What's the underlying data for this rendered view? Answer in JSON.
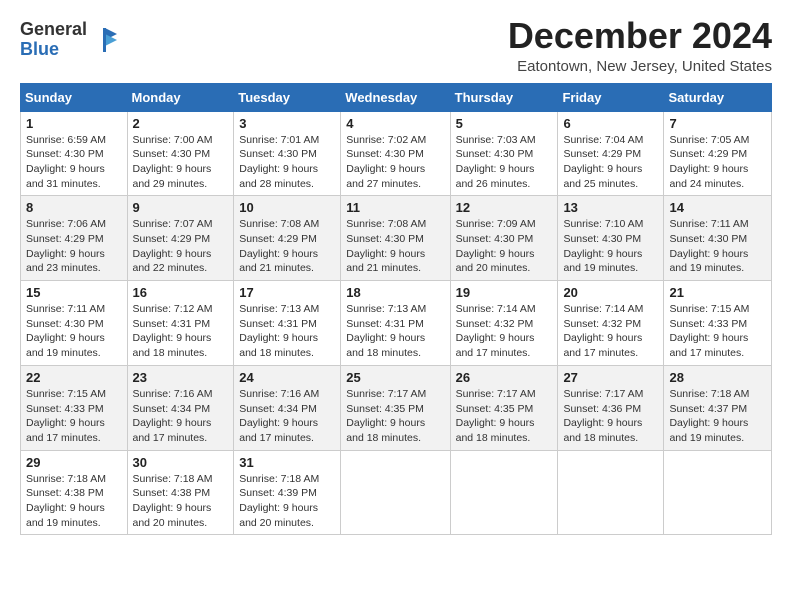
{
  "header": {
    "logo_general": "General",
    "logo_blue": "Blue",
    "month_title": "December 2024",
    "location": "Eatontown, New Jersey, United States"
  },
  "days_of_week": [
    "Sunday",
    "Monday",
    "Tuesday",
    "Wednesday",
    "Thursday",
    "Friday",
    "Saturday"
  ],
  "weeks": [
    [
      {
        "day": "1",
        "info": "Sunrise: 6:59 AM\nSunset: 4:30 PM\nDaylight: 9 hours\nand 31 minutes."
      },
      {
        "day": "2",
        "info": "Sunrise: 7:00 AM\nSunset: 4:30 PM\nDaylight: 9 hours\nand 29 minutes."
      },
      {
        "day": "3",
        "info": "Sunrise: 7:01 AM\nSunset: 4:30 PM\nDaylight: 9 hours\nand 28 minutes."
      },
      {
        "day": "4",
        "info": "Sunrise: 7:02 AM\nSunset: 4:30 PM\nDaylight: 9 hours\nand 27 minutes."
      },
      {
        "day": "5",
        "info": "Sunrise: 7:03 AM\nSunset: 4:30 PM\nDaylight: 9 hours\nand 26 minutes."
      },
      {
        "day": "6",
        "info": "Sunrise: 7:04 AM\nSunset: 4:29 PM\nDaylight: 9 hours\nand 25 minutes."
      },
      {
        "day": "7",
        "info": "Sunrise: 7:05 AM\nSunset: 4:29 PM\nDaylight: 9 hours\nand 24 minutes."
      }
    ],
    [
      {
        "day": "8",
        "info": "Sunrise: 7:06 AM\nSunset: 4:29 PM\nDaylight: 9 hours\nand 23 minutes."
      },
      {
        "day": "9",
        "info": "Sunrise: 7:07 AM\nSunset: 4:29 PM\nDaylight: 9 hours\nand 22 minutes."
      },
      {
        "day": "10",
        "info": "Sunrise: 7:08 AM\nSunset: 4:29 PM\nDaylight: 9 hours\nand 21 minutes."
      },
      {
        "day": "11",
        "info": "Sunrise: 7:08 AM\nSunset: 4:30 PM\nDaylight: 9 hours\nand 21 minutes."
      },
      {
        "day": "12",
        "info": "Sunrise: 7:09 AM\nSunset: 4:30 PM\nDaylight: 9 hours\nand 20 minutes."
      },
      {
        "day": "13",
        "info": "Sunrise: 7:10 AM\nSunset: 4:30 PM\nDaylight: 9 hours\nand 19 minutes."
      },
      {
        "day": "14",
        "info": "Sunrise: 7:11 AM\nSunset: 4:30 PM\nDaylight: 9 hours\nand 19 minutes."
      }
    ],
    [
      {
        "day": "15",
        "info": "Sunrise: 7:11 AM\nSunset: 4:30 PM\nDaylight: 9 hours\nand 19 minutes."
      },
      {
        "day": "16",
        "info": "Sunrise: 7:12 AM\nSunset: 4:31 PM\nDaylight: 9 hours\nand 18 minutes."
      },
      {
        "day": "17",
        "info": "Sunrise: 7:13 AM\nSunset: 4:31 PM\nDaylight: 9 hours\nand 18 minutes."
      },
      {
        "day": "18",
        "info": "Sunrise: 7:13 AM\nSunset: 4:31 PM\nDaylight: 9 hours\nand 18 minutes."
      },
      {
        "day": "19",
        "info": "Sunrise: 7:14 AM\nSunset: 4:32 PM\nDaylight: 9 hours\nand 17 minutes."
      },
      {
        "day": "20",
        "info": "Sunrise: 7:14 AM\nSunset: 4:32 PM\nDaylight: 9 hours\nand 17 minutes."
      },
      {
        "day": "21",
        "info": "Sunrise: 7:15 AM\nSunset: 4:33 PM\nDaylight: 9 hours\nand 17 minutes."
      }
    ],
    [
      {
        "day": "22",
        "info": "Sunrise: 7:15 AM\nSunset: 4:33 PM\nDaylight: 9 hours\nand 17 minutes."
      },
      {
        "day": "23",
        "info": "Sunrise: 7:16 AM\nSunset: 4:34 PM\nDaylight: 9 hours\nand 17 minutes."
      },
      {
        "day": "24",
        "info": "Sunrise: 7:16 AM\nSunset: 4:34 PM\nDaylight: 9 hours\nand 17 minutes."
      },
      {
        "day": "25",
        "info": "Sunrise: 7:17 AM\nSunset: 4:35 PM\nDaylight: 9 hours\nand 18 minutes."
      },
      {
        "day": "26",
        "info": "Sunrise: 7:17 AM\nSunset: 4:35 PM\nDaylight: 9 hours\nand 18 minutes."
      },
      {
        "day": "27",
        "info": "Sunrise: 7:17 AM\nSunset: 4:36 PM\nDaylight: 9 hours\nand 18 minutes."
      },
      {
        "day": "28",
        "info": "Sunrise: 7:18 AM\nSunset: 4:37 PM\nDaylight: 9 hours\nand 19 minutes."
      }
    ],
    [
      {
        "day": "29",
        "info": "Sunrise: 7:18 AM\nSunset: 4:38 PM\nDaylight: 9 hours\nand 19 minutes."
      },
      {
        "day": "30",
        "info": "Sunrise: 7:18 AM\nSunset: 4:38 PM\nDaylight: 9 hours\nand 20 minutes."
      },
      {
        "day": "31",
        "info": "Sunrise: 7:18 AM\nSunset: 4:39 PM\nDaylight: 9 hours\nand 20 minutes."
      },
      null,
      null,
      null,
      null
    ]
  ]
}
